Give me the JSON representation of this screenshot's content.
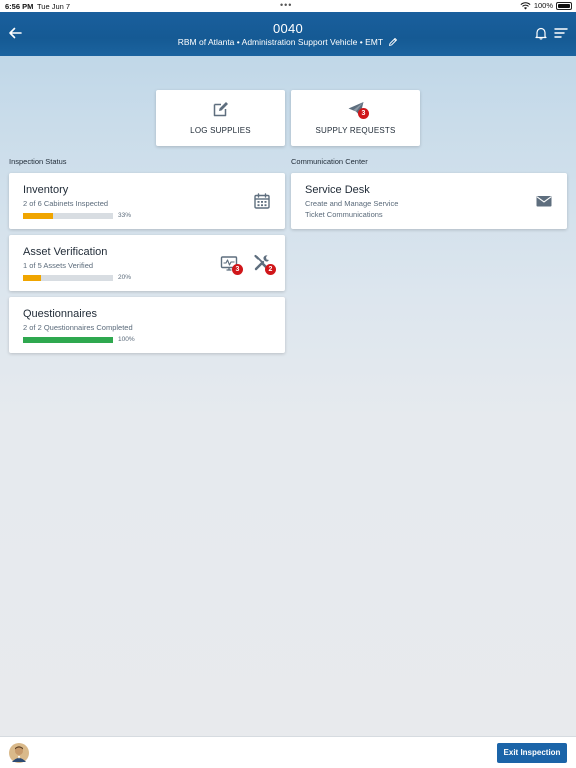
{
  "status_bar": {
    "time": "6:56 PM",
    "date": "Tue Jun 7",
    "battery": "100%"
  },
  "header": {
    "title": "0040",
    "subtitle": "RBM of Atlanta • Administration Support Vehicle • EMT"
  },
  "actions": [
    {
      "label": "LOG SUPPLIES",
      "icon": "edit-icon"
    },
    {
      "label": "SUPPLY REQUESTS",
      "icon": "paper-plane-icon",
      "badge": "3"
    }
  ],
  "sections": {
    "inspection_status": "Inspection Status",
    "communication_center": "Communication Center"
  },
  "inspection_cards": {
    "inventory": {
      "title": "Inventory",
      "subtitle": "2 of 6 Cabinets Inspected",
      "progress_label": "33%",
      "progress": 0.33,
      "bar_color": "#f0a500",
      "icon": "calendar-icon"
    },
    "asset_verification": {
      "title": "Asset Verification",
      "subtitle": "1 of 5 Assets Verified",
      "progress_label": "20%",
      "progress": 0.2,
      "bar_color": "#f0a500",
      "monitor_badge": "3",
      "tools_badge": "2"
    },
    "questionnaires": {
      "title": "Questionnaires",
      "subtitle": "2 of 2 Questionnaires Completed",
      "progress_label": "100%",
      "progress": 1.0,
      "bar_color": "#2fa84f"
    }
  },
  "service_desk": {
    "title": "Service Desk",
    "line1": "Create and Manage Service",
    "line2": "Ticket Communications",
    "icon": "envelope-icon"
  },
  "footer": {
    "exit_label": "Exit Inspection"
  },
  "colors": {
    "header_blue": "#1a5f9d",
    "accent_blue": "#1b64a8",
    "badge_red": "#d0161a",
    "progress_orange": "#f0a500",
    "progress_green": "#2fa84f"
  }
}
